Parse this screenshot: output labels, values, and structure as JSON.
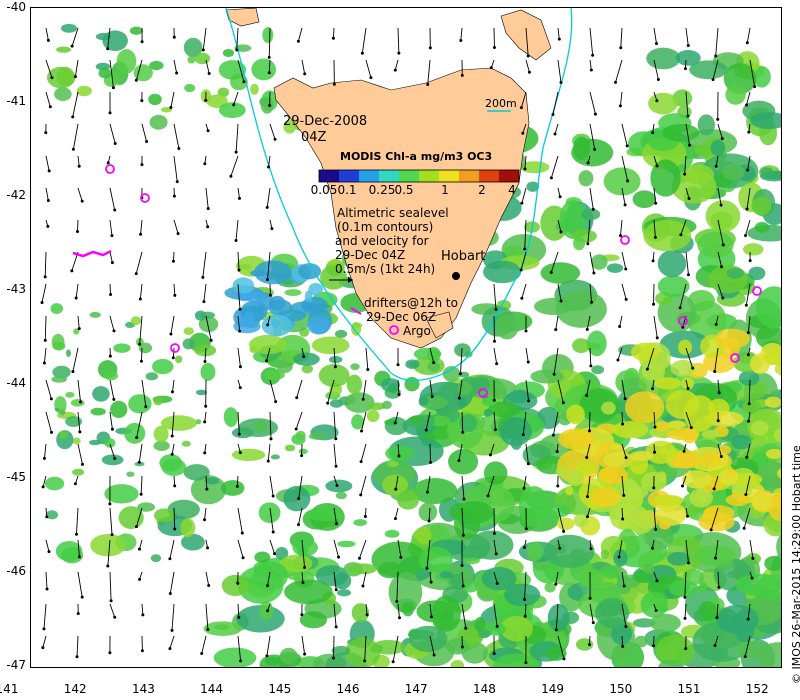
{
  "map": {
    "date_label": "29-Dec-2008",
    "time_label": "04Z",
    "colorbar": {
      "title": "MODIS Chl-a mg/m3 OC3",
      "ticks": [
        "0.05",
        "0.1",
        "0.25",
        "0.5",
        "1",
        "2",
        "4"
      ],
      "colors": [
        "#1a0a8c",
        "#1f3fd8",
        "#23a0e8",
        "#2fd8c0",
        "#4fd84f",
        "#a0e020",
        "#f0e020",
        "#f0a020",
        "#e04010",
        "#a01008"
      ]
    },
    "altimetry_text": [
      "Altimetric sealevel",
      "(0.1m contours)",
      "and velocity for",
      "29-Dec 04Z",
      "0.5m/s (1kt 24h)"
    ],
    "drifters_text": [
      "drifters@12h to",
      "29-Dec 06Z"
    ],
    "argo_label": "Argo",
    "city_label": "Hobart",
    "depth_label": "200m",
    "y_ticks": [
      "-40",
      "-41",
      "-42",
      "-43",
      "-44",
      "-45",
      "-46",
      "-47"
    ],
    "x_ticks": [
      "141",
      "142",
      "143",
      "144",
      "145",
      "146",
      "147",
      "148",
      "149",
      "150",
      "151",
      "152"
    ],
    "credit": "© IMOS 26-Mar-2015 14:29:00 Hobart time",
    "land_color": "#ffcc99",
    "bathymetry_color": "#00ccdd",
    "argo_color": "#ff00ff"
  }
}
